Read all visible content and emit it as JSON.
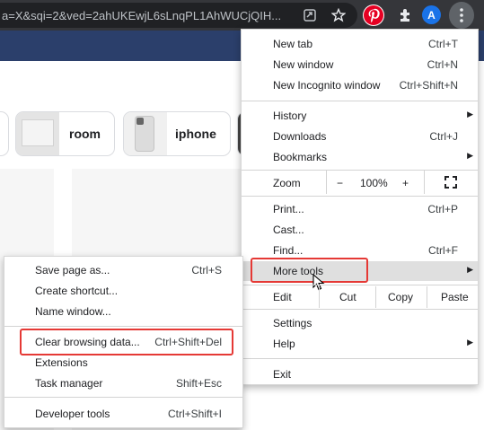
{
  "toolbar": {
    "url_fragment": "a=X&sqi=2&ved=2ahUKEwjL6sLnqPL1AhWUCjQIH...",
    "avatar_letter": "A"
  },
  "page": {
    "chips": [
      {
        "label": "room"
      },
      {
        "label": "iphone"
      }
    ]
  },
  "chrome_menu": {
    "new_tab": {
      "label": "New tab",
      "shortcut": "Ctrl+T"
    },
    "new_window": {
      "label": "New window",
      "shortcut": "Ctrl+N"
    },
    "new_incognito": {
      "label": "New Incognito window",
      "shortcut": "Ctrl+Shift+N"
    },
    "history": {
      "label": "History"
    },
    "downloads": {
      "label": "Downloads",
      "shortcut": "Ctrl+J"
    },
    "bookmarks": {
      "label": "Bookmarks"
    },
    "zoom": {
      "label": "Zoom",
      "minus": "−",
      "value": "100%",
      "plus": "+"
    },
    "print": {
      "label": "Print...",
      "shortcut": "Ctrl+P"
    },
    "cast": {
      "label": "Cast..."
    },
    "find": {
      "label": "Find...",
      "shortcut": "Ctrl+F"
    },
    "more_tools": {
      "label": "More tools"
    },
    "edit": {
      "label": "Edit",
      "cut": "Cut",
      "copy": "Copy",
      "paste": "Paste"
    },
    "settings": {
      "label": "Settings"
    },
    "help": {
      "label": "Help"
    },
    "exit": {
      "label": "Exit"
    }
  },
  "more_tools_menu": {
    "save_page": {
      "label": "Save page as...",
      "shortcut": "Ctrl+S"
    },
    "create_shortcut": {
      "label": "Create shortcut..."
    },
    "name_window": {
      "label": "Name window..."
    },
    "clear_browsing": {
      "label": "Clear browsing data...",
      "shortcut": "Ctrl+Shift+Del"
    },
    "extensions": {
      "label": "Extensions"
    },
    "task_manager": {
      "label": "Task manager",
      "shortcut": "Shift+Esc"
    },
    "developer_tools": {
      "label": "Developer tools",
      "shortcut": "Ctrl+Shift+I"
    }
  },
  "colors": {
    "highlight_box": "#e53935",
    "toolbar_bg": "#35363a",
    "omnibox_bg": "#202124",
    "page_band": "#2b3f6b",
    "hover_row": "#dfdfdf"
  }
}
